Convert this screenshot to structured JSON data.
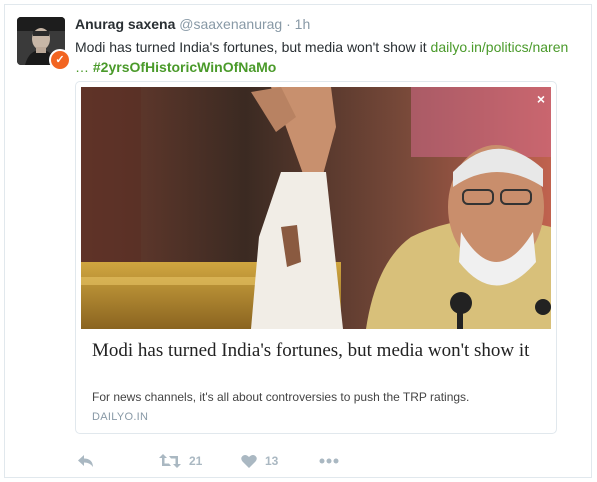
{
  "author": {
    "name": "Anurag saxena",
    "handle": "@saaxenanurag",
    "separator": "·",
    "time": "1h"
  },
  "tweet": {
    "text": "Modi has turned India's fortunes, but media won't show it",
    "link": "dailyo.in/politics/naren",
    "ellipsis": "…",
    "hashtag": "#2yrsOfHistoricWinOfNaMo"
  },
  "card": {
    "close_glyph": "×",
    "title": "Modi has turned India's fortunes, but media won't show it",
    "description": "For news channels, it's all about controversies to push the TRP ratings.",
    "domain": "DAILYO.IN"
  },
  "actions": {
    "retweets": "21",
    "likes": "13"
  },
  "icons": {
    "reply": "reply-icon",
    "retweet": "retweet-icon",
    "like": "heart-icon",
    "more": "more-icon",
    "verified": "verified-icon"
  },
  "colors": {
    "link": "#4a9a2a",
    "muted": "#8899a6",
    "action": "#aab8c2",
    "verified": "#f26522"
  }
}
